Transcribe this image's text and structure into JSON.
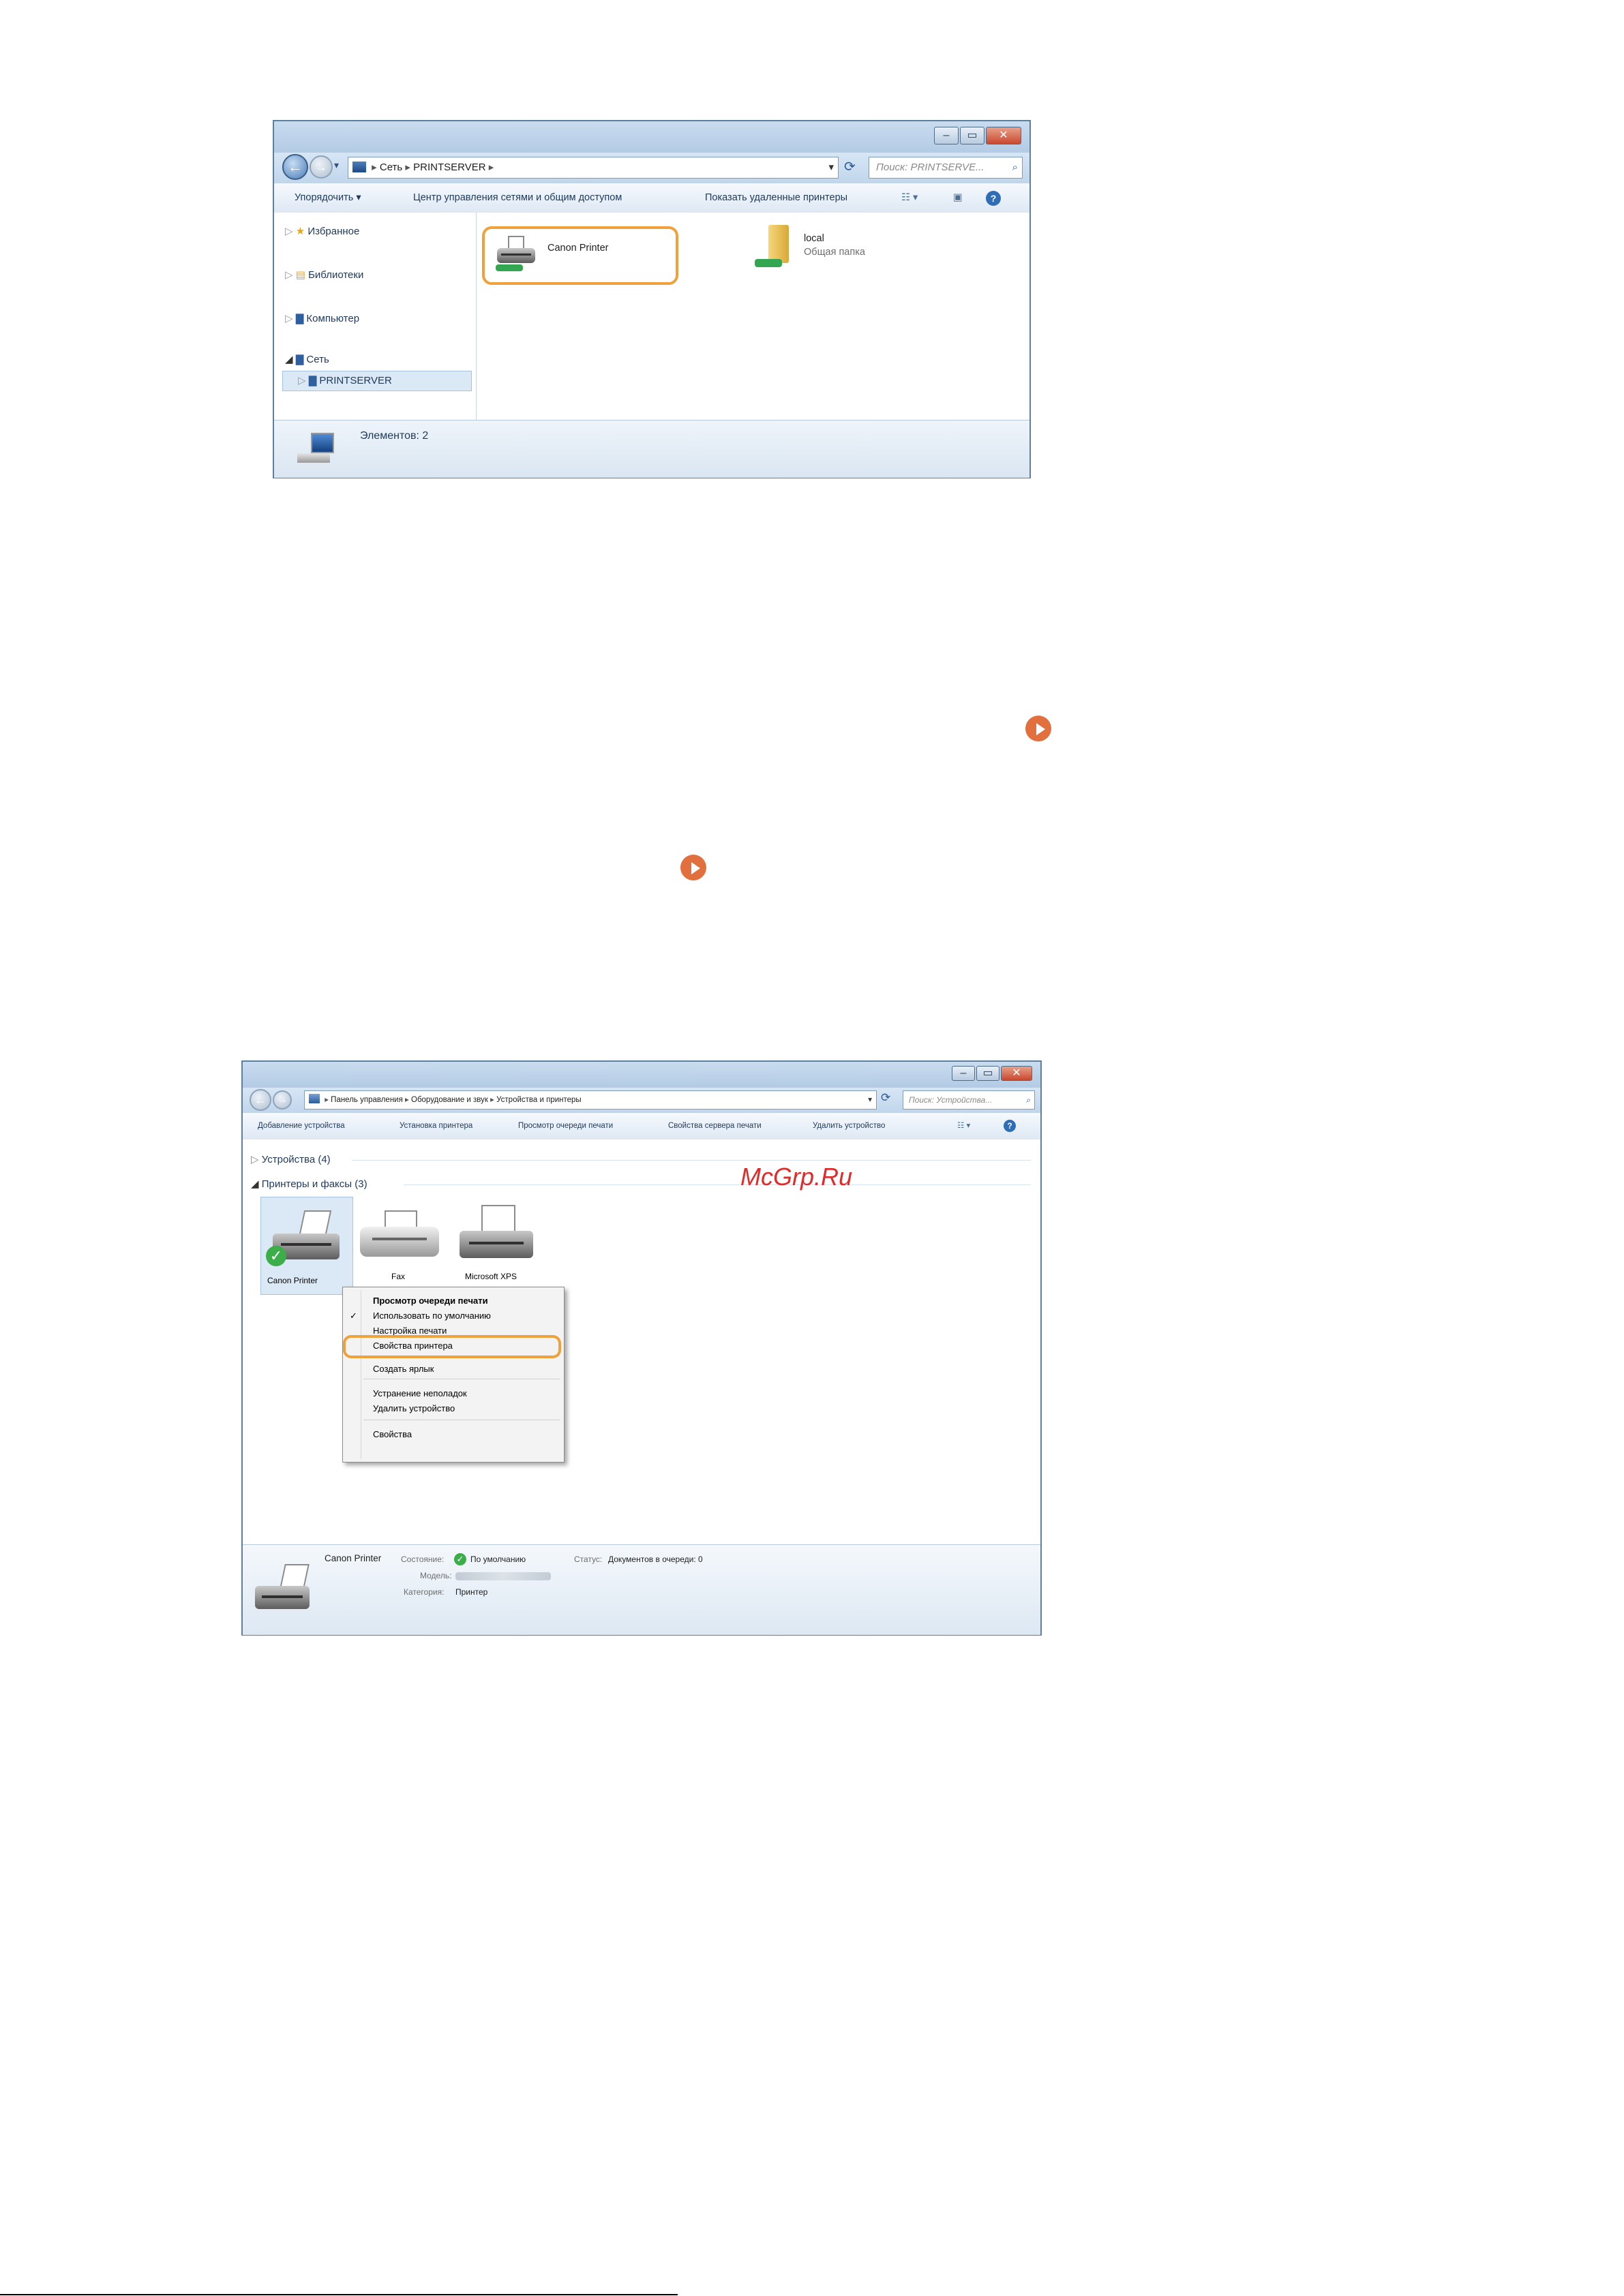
{
  "window1": {
    "address": [
      "Сеть",
      "PRINTSERVER"
    ],
    "search_placeholder": "Поиск: PRINTSERVE...",
    "toolbar": [
      "Упорядочить ▾",
      "Центр управления сетями и общим доступом",
      "Показать удаленные принтеры"
    ],
    "nav": [
      "Избранное",
      "Библиотеки",
      "Компьютер",
      "Сеть",
      "PRINTSERVER"
    ],
    "items": [
      {
        "name": "Canon Printer"
      },
      {
        "name": "local",
        "sub": "Общая папка"
      }
    ],
    "status": "Элементов: 2"
  },
  "window2": {
    "address": [
      "Панель управления",
      "Оборудование и звук",
      "Устройства и принтеры"
    ],
    "search_placeholder": "Поиск: Устройства...",
    "toolbar": [
      "Добавление устройства",
      "Установка принтера",
      "Просмотр очереди печати",
      "Свойства сервера печати",
      "Удалить устройство"
    ],
    "groups": [
      "Устройства (4)",
      "Принтеры и факсы (3)"
    ],
    "printers": [
      "Canon Printer",
      "Fax",
      "Microsoft XPS"
    ],
    "context_menu": [
      "Просмотр очереди печати",
      "Использовать по умолчанию",
      "Настройка печати",
      "Свойства принтера",
      "Создать ярлык",
      "Устранение неполадок",
      "Удалить устройство",
      "Свойства"
    ],
    "details": {
      "name": "Canon Printer",
      "state_label": "Состояние:",
      "state_value": "По умолчанию",
      "status_label": "Статус:",
      "status_value": "Документов в очереди: 0",
      "model_label": "Модель:",
      "category_label": "Категория:",
      "category_value": "Принтер"
    }
  },
  "watermark": "McGrp.Ru",
  "colors": {
    "highlight": "#f0a13b",
    "arrow": "#e2703f"
  }
}
